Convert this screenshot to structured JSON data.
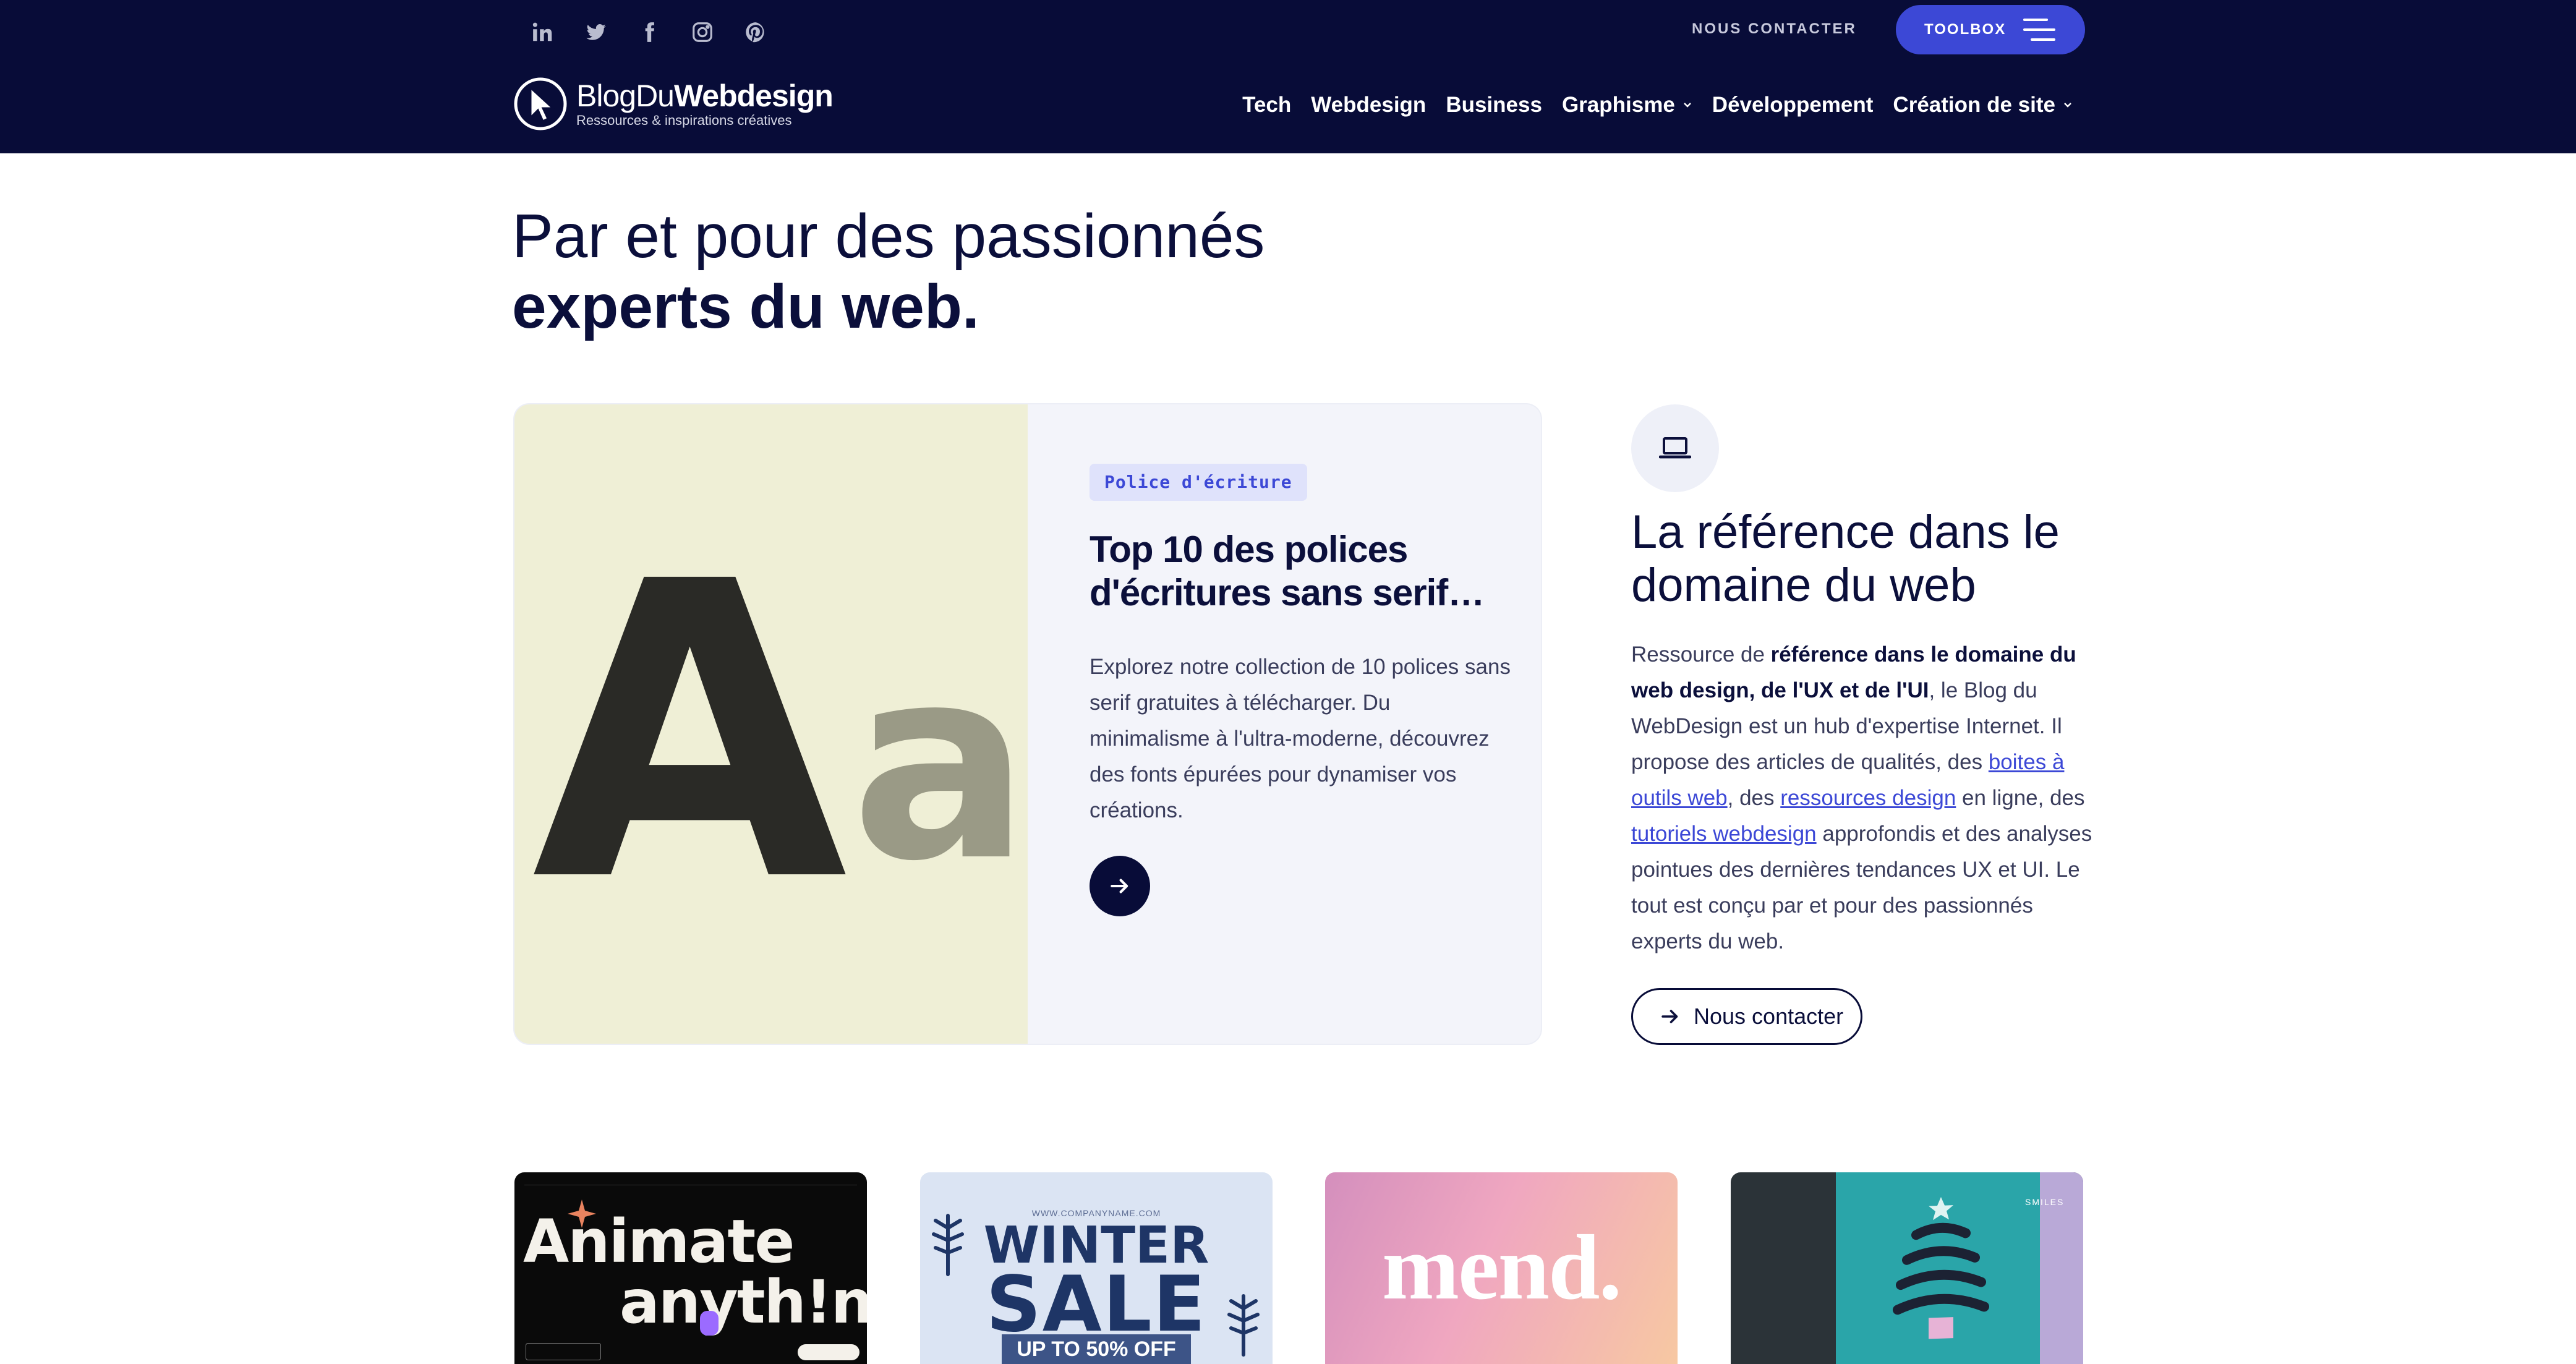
{
  "header": {
    "social_icons": [
      "linkedin-icon",
      "twitter-icon",
      "facebook-icon",
      "instagram-icon",
      "pinterest-icon"
    ],
    "contact_label": "NOUS CONTACTER",
    "toolbox_label": "TOOLBOX",
    "logo": {
      "title_light": "BlogDu",
      "title_bold": "Webdesign",
      "subtitle": "Ressources & inspirations créatives"
    },
    "nav": [
      {
        "label": "Tech",
        "has_dropdown": false
      },
      {
        "label": "Webdesign",
        "has_dropdown": false
      },
      {
        "label": "Business",
        "has_dropdown": false
      },
      {
        "label": "Graphisme",
        "has_dropdown": true
      },
      {
        "label": "Développement",
        "has_dropdown": false
      },
      {
        "label": "Création de site",
        "has_dropdown": true
      }
    ]
  },
  "hero": {
    "line1": "Par et pour des passionnés",
    "line2": "experts du web."
  },
  "feature": {
    "image_letters": {
      "big": "A",
      "small": "a"
    },
    "tag": "Police d'écriture",
    "title": "Top 10 des polices d'écritures sans serif…",
    "description": "Explorez notre collection de 10 polices sans serif gratuites à télécharger. Du minimalisme à l'ultra-moderne, découvrez des fonts épurées pour dynamiser vos créations."
  },
  "sidebar": {
    "icon": "laptop-icon",
    "title": "La référence dans le domaine du web",
    "text": {
      "p1": "Ressource de ",
      "b1": "référence dans le domaine du web design, de l'UX et de l'UI",
      "p2": ", le Blog du WebDesign est un hub d'expertise Internet. Il propose des articles de qualités, des ",
      "link1": "boites à outils web",
      "p3": ", des ",
      "link2": "ressources design",
      "p4": " en ligne, des ",
      "link3": "tutoriels webdesign",
      "p5": " approfondis et des analyses pointues des dernières tendances UX et UI. Le tout est conçu par et pour des passionnés experts du web."
    },
    "contact_button": "Nous contacter"
  },
  "thumbnails": {
    "t1": {
      "line1": "Animate",
      "line2": "anyth!ng"
    },
    "t2": {
      "url": "WWW.COMPANYNAME.COM",
      "winter": "WINTER",
      "sale": "SALE",
      "offer": "UP TO 50% OFF"
    },
    "t3": {
      "word": "mend."
    },
    "t4": {
      "label": "SMILES"
    }
  },
  "colors": {
    "header_bg": "#080c38",
    "accent": "#3c48d6",
    "text_dark": "#0b0f3b",
    "card_bg": "#f3f4fa"
  }
}
